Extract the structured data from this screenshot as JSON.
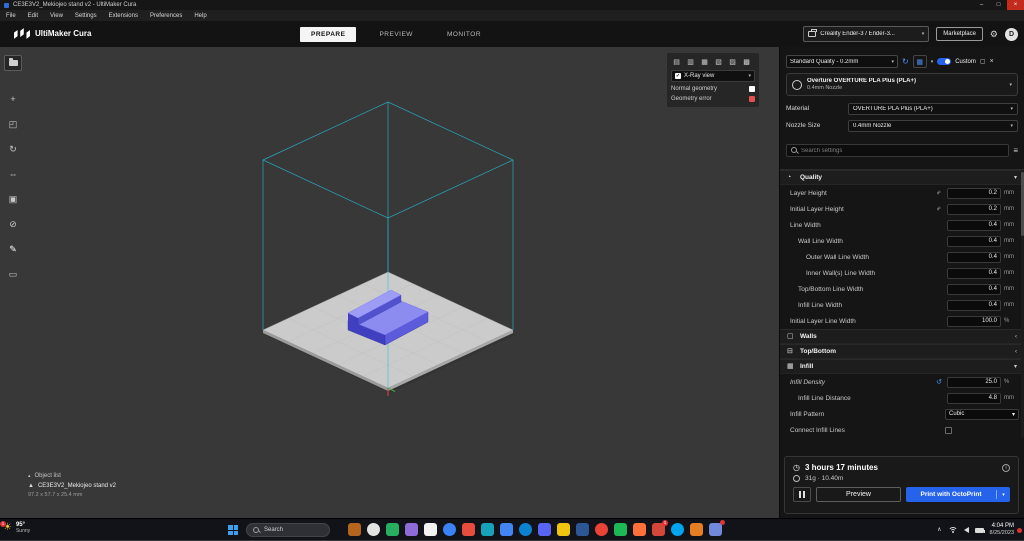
{
  "window": {
    "title": "CE3E3V2_Mekiojeo stand v2 - UltiMaker Cura"
  },
  "menu": {
    "items": [
      "File",
      "Edit",
      "View",
      "Settings",
      "Extensions",
      "Preferences",
      "Help"
    ]
  },
  "header": {
    "app_name": "UltiMaker Cura",
    "tabs": [
      {
        "label": "PREPARE",
        "active": true
      },
      {
        "label": "PREVIEW",
        "active": false
      },
      {
        "label": "MONITOR",
        "active": false
      }
    ],
    "printer": "Creality Ender-3 / Ender-3...",
    "marketplace": "Marketplace",
    "avatar": "D"
  },
  "toolbar": {
    "tools": [
      {
        "name": "move",
        "glyph": "+"
      },
      {
        "name": "scale",
        "glyph": "◰"
      },
      {
        "name": "rotate",
        "glyph": "↻"
      },
      {
        "name": "mirror",
        "glyph": "⇔"
      },
      {
        "name": "per-model-settings",
        "glyph": "▣"
      },
      {
        "name": "support-blocker",
        "glyph": "⊘"
      },
      {
        "name": "pen",
        "glyph": "✎"
      },
      {
        "name": "measure",
        "glyph": "▭"
      }
    ]
  },
  "view_panel": {
    "icons": [
      "▤",
      "▥",
      "▦",
      "▧",
      "▨",
      "▩"
    ],
    "mode": "X-Ray view",
    "legend": [
      {
        "label": "Normal geometry"
      },
      {
        "label": "Geometry error"
      }
    ]
  },
  "object_list": {
    "header": "Object list",
    "item": "CE3E3V2_Mekiojeo stand v2",
    "dimensions": "97.2 x 57.7 x 25.4 mm"
  },
  "print_setup": {
    "profile": "Standard Quality - 0.2mm",
    "custom": "Custom",
    "material_line1": "Overture OVERTURE PLA Plus (PLA+)",
    "material_line2": "0.4mm Nozzle",
    "rows": [
      {
        "label": "Material",
        "value": "OVERTURE PLA Plus (PLA+)"
      },
      {
        "label": "Nozzle Size",
        "value": "0.4mm Nozzle"
      }
    ],
    "search_placeholder": "Search settings",
    "sections": [
      {
        "title": "Quality",
        "settings": [
          {
            "label": "Layer Height",
            "value": "0.2",
            "unit": "mm"
          },
          {
            "label": "Initial Layer Height",
            "value": "0.2",
            "unit": "mm"
          },
          {
            "label": "Line Width",
            "value": "0.4",
            "unit": "mm"
          },
          {
            "label": "Wall Line Width",
            "value": "0.4",
            "unit": "mm"
          },
          {
            "label": "Outer Wall Line Width",
            "value": "0.4",
            "unit": "mm"
          },
          {
            "label": "Inner Wall(s) Line Width",
            "value": "0.4",
            "unit": "mm"
          },
          {
            "label": "Top/Bottom Line Width",
            "value": "0.4",
            "unit": "mm"
          },
          {
            "label": "Infill Line Width",
            "value": "0.4",
            "unit": "mm"
          },
          {
            "label": "Initial Layer Line Width",
            "value": "100.0",
            "unit": "%"
          }
        ]
      },
      {
        "title": "Walls"
      },
      {
        "title": "Top/Bottom"
      },
      {
        "title": "Infill",
        "settings": [
          {
            "label": "Infill Density",
            "value": "25.0",
            "unit": "%"
          },
          {
            "label": "Infill Line Distance",
            "value": "4.8",
            "unit": "mm"
          },
          {
            "label": "Infill Pattern",
            "value": "Cubic"
          },
          {
            "label": "Connect Infill Lines"
          }
        ]
      }
    ]
  },
  "action_panel": {
    "time": "3 hours 17 minutes",
    "material": "31g · 10.40m",
    "preview": "Preview",
    "print": "Print with OctoPrint"
  },
  "taskbar": {
    "weather_temp": "95°",
    "weather_cond": "Sunny",
    "weather_badge": "1",
    "search": "Search",
    "time": "4:04 PM",
    "date": "8/25/2023",
    "badge": "1",
    "icons": [
      "#b5651d",
      "#e3e3e3",
      "#27ae60",
      "#8e6cd8",
      "#f2f2f2",
      "#3b82f6",
      "#e74c3c",
      "#16a2b8",
      "#4285f4",
      "#0a84d0",
      "#5865f2",
      "#f1c40f",
      "#2b5797",
      "#ea4335",
      "#1db954",
      "#ff7139",
      "#d44638",
      "#00a4ef",
      "#e67e22",
      "#7289da"
    ]
  },
  "colors": {
    "accent": "#2563eb",
    "xray_error": "#e25050",
    "normal_geometry": "#ffffff",
    "wireframe": "#25c4de",
    "build_plate": "#cbcbcb",
    "model": "#8b8bf0"
  }
}
